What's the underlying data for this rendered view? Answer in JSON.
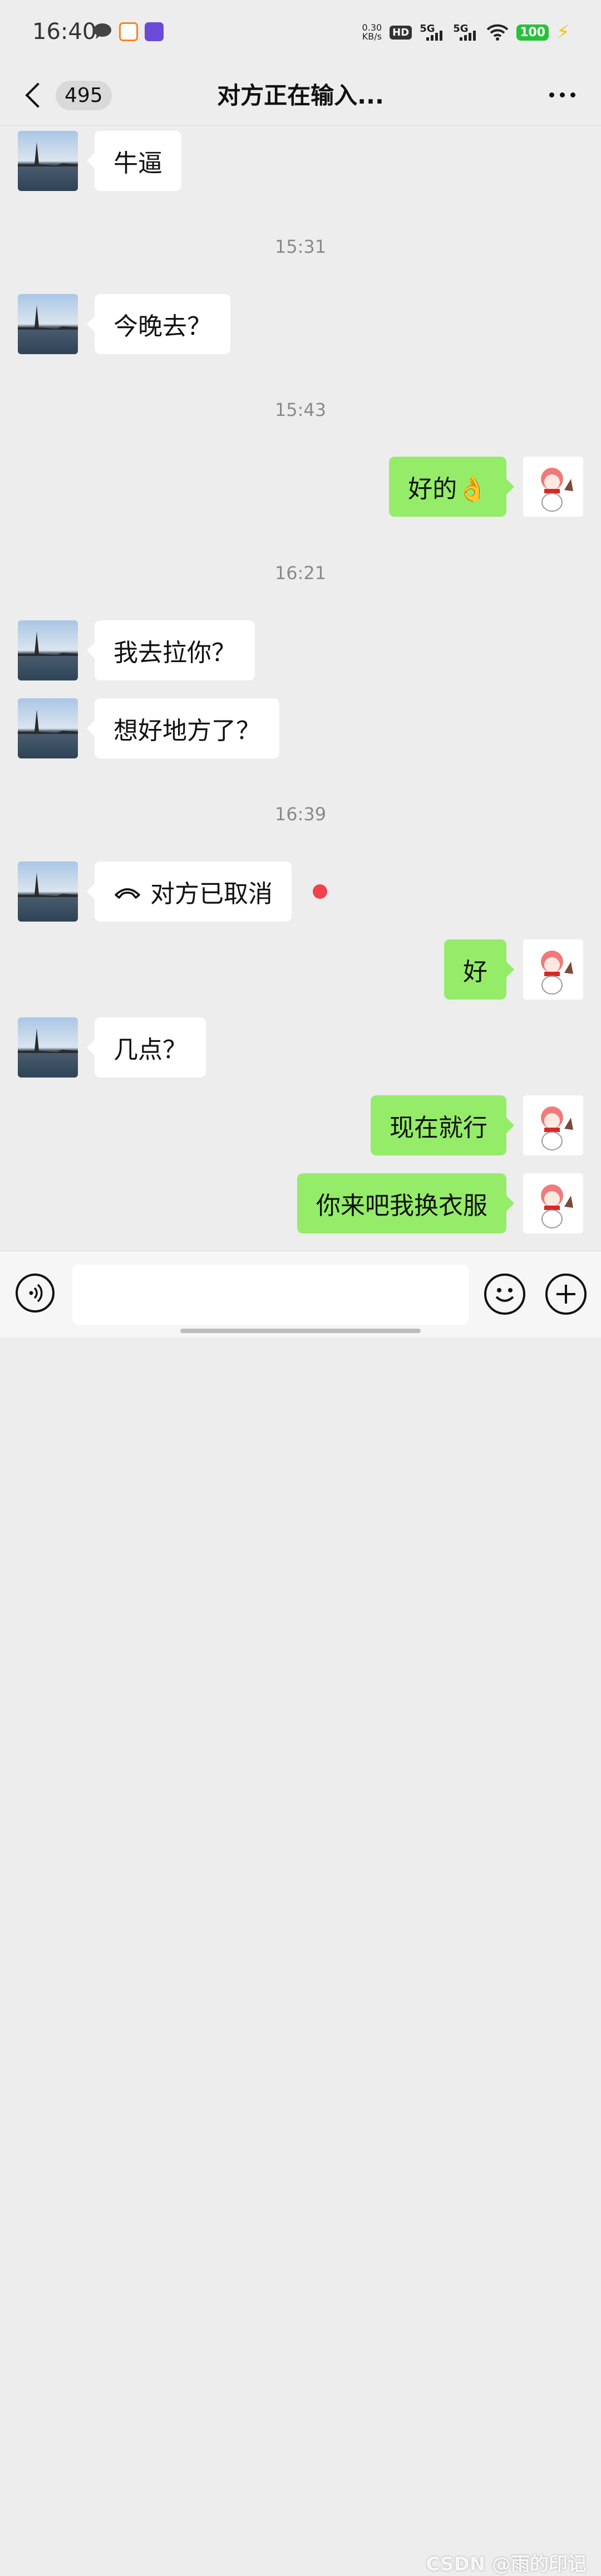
{
  "status_bar": {
    "time": "16:40",
    "speed_value": "0.30",
    "speed_unit": "KB/s",
    "hd": "HD",
    "net1": "5G",
    "net2": "5G",
    "battery": "100"
  },
  "header": {
    "unread_count": "495",
    "title": "对方正在输入..."
  },
  "messages": [
    {
      "side": "left",
      "text": "牛逼"
    },
    {
      "side": "time",
      "text": "15:31"
    },
    {
      "side": "left",
      "text": "今晚去？"
    },
    {
      "side": "time",
      "text": "15:43"
    },
    {
      "side": "right",
      "text": "好的👌"
    },
    {
      "side": "time",
      "text": "16:21"
    },
    {
      "side": "left",
      "text": "我去拉你？"
    },
    {
      "side": "left",
      "text": "想好地方了？"
    },
    {
      "side": "time",
      "text": "16:39"
    },
    {
      "side": "left",
      "text": "对方已取消",
      "kind": "call"
    },
    {
      "side": "right",
      "text": "好"
    },
    {
      "side": "left",
      "text": "几点？"
    },
    {
      "side": "right",
      "text": "现在就行"
    },
    {
      "side": "right",
      "text": "你来吧我换衣服"
    }
  ],
  "input": {
    "placeholder": ""
  },
  "watermark": "CSDN @雨的印记",
  "colors": {
    "background": "#ededed",
    "sent_bubble": "#95ec69",
    "received_bubble": "#ffffff",
    "unread_dot": "#f0434d",
    "battery": "#27c13a"
  }
}
